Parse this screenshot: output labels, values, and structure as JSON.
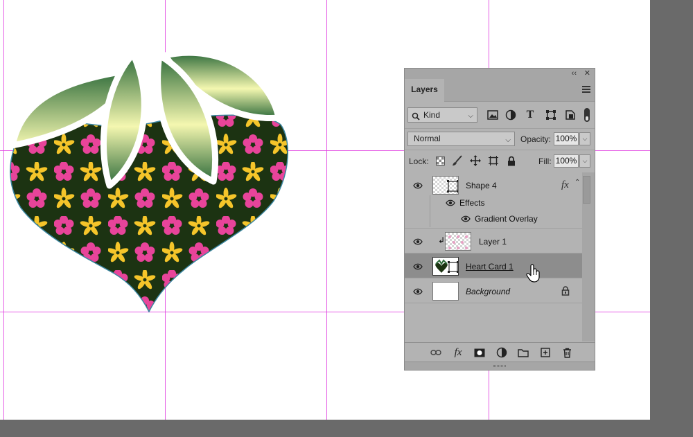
{
  "panel": {
    "title": "Layers",
    "collapse_glyph": "‹‹",
    "close_glyph": "✕",
    "filter": {
      "kind_label": "Kind"
    },
    "blend_mode": "Normal",
    "opacity_label": "Opacity:",
    "opacity_value": "100%",
    "lock_label": "Lock:",
    "fill_label": "Fill:",
    "fill_value": "100%"
  },
  "layers": [
    {
      "name": "Shape 4",
      "fx": "fx",
      "effects_label": "Effects",
      "effect_name": "Gradient Overlay"
    },
    {
      "name": "Layer 1",
      "clipped": true
    },
    {
      "name": "Heart Card 1",
      "selected": true
    },
    {
      "name": "Background",
      "locked": true
    }
  ],
  "colors": {
    "guide": "#e040e0",
    "leaf_dark": "#2e6b3a",
    "leaf_light": "#f4f7b0",
    "heart_fill": "#1c3312",
    "flower_pink": "#e8449a",
    "flower_yellow": "#f5c52a",
    "panel_bg": "#b3b3b3",
    "selected_row": "#8d8d8d"
  },
  "icons": [
    "search-icon",
    "image-filter-icon",
    "adjustment-filter-icon",
    "type-filter-icon",
    "shape-filter-icon",
    "smart-object-filter-icon",
    "filter-toggle-icon",
    "lock-transparent-icon",
    "lock-paint-icon",
    "lock-move-icon",
    "lock-artboard-icon",
    "lock-all-icon",
    "eye-icon",
    "link-icon",
    "fx-icon",
    "mask-icon",
    "adjustment-layer-icon",
    "folder-icon",
    "new-layer-icon",
    "trash-icon",
    "hand-cursor-icon"
  ]
}
